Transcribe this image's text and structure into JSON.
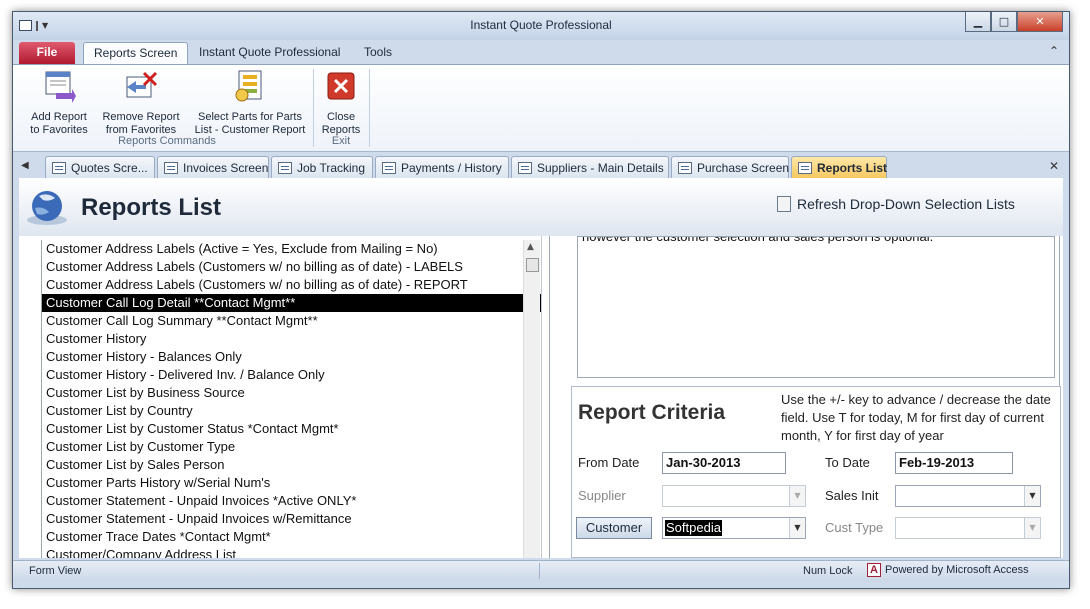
{
  "window": {
    "title": "Instant Quote Professional"
  },
  "ribbon_tabs": [
    "File",
    "Reports Screen",
    "Instant Quote Professional",
    "Tools"
  ],
  "ribbon": {
    "buttons": [
      {
        "label1": "Add Report",
        "label2": "to Favorites"
      },
      {
        "label1": "Remove Report",
        "label2": "from Favorites"
      },
      {
        "label1": "Select Parts for Parts",
        "label2": "List - Customer Report"
      },
      {
        "label1": "Close",
        "label2": "Reports"
      }
    ],
    "groups": [
      "Reports Commands",
      "Exit"
    ]
  },
  "doc_tabs": [
    "Quotes Scre...",
    "Invoices Screen",
    "Job Tracking",
    "Payments / History",
    "Suppliers - Main Details",
    "Purchase Screen",
    "Reports List"
  ],
  "form": {
    "title": "Reports List",
    "refresh_label": "Refresh Drop-Down Selection Lists"
  },
  "reports": [
    "Customer Address Labels (Active = Yes, Exclude from Mailing = No)",
    "Customer Address Labels (Customers w/ no billing as of date) - LABELS",
    "Customer Address Labels (Customers w/ no billing as of date) - REPORT",
    "Customer Call Log Detail **Contact Mgmt**",
    "Customer Call Log Summary **Contact Mgmt**",
    "Customer History",
    "Customer History - Balances Only",
    "Customer History - Delivered Inv. / Balance Only",
    "Customer List by Business Source",
    "Customer List by Country",
    "Customer List by Customer Status   *Contact Mgmt*",
    "Customer List by Customer Type",
    "Customer List by Sales Person",
    "Customer Parts History w/Serial Num's",
    "Customer Statement - Unpaid Invoices *Active ONLY*",
    "Customer Statement - Unpaid Invoices w/Remittance",
    "Customer Trace Dates   *Contact Mgmt*",
    "Customer/Company Address List"
  ],
  "selected_index": 3,
  "notes_text": "however the customer selection and sales person is optional.***",
  "criteria": {
    "title": "Report Criteria",
    "help": "Use the +/- key to advance / decrease the date field. Use T for today, M for first day of current month, Y for first day of year",
    "from_label": "From Date",
    "from_value": "Jan-30-2013",
    "to_label": "To Date",
    "to_value": "Feb-19-2013",
    "supplier_label": "Supplier",
    "sales_init_label": "Sales Init",
    "customer_button": "Customer",
    "customer_value": "Softpedia",
    "cust_type_label": "Cust Type"
  },
  "status": {
    "view": "Form View",
    "numlock": "Num Lock",
    "powered": "Powered by Microsoft Access"
  }
}
